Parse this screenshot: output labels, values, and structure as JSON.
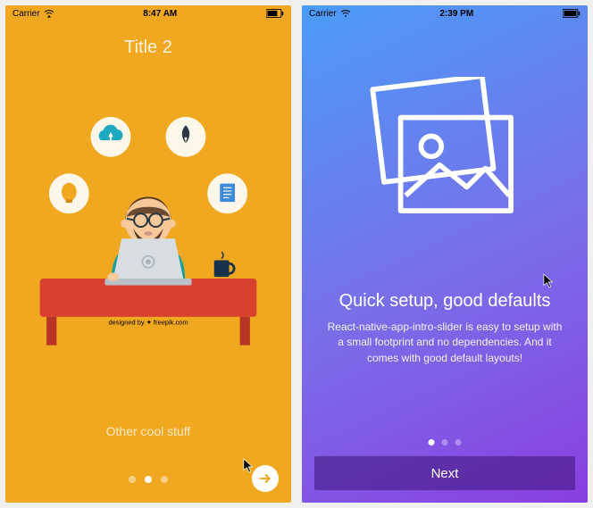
{
  "left": {
    "statusbar": {
      "carrier": "Carrier",
      "time": "8:47 AM"
    },
    "title": "Title 2",
    "attribution": "designed by ✦ freepik.com",
    "subtitle": "Other cool stuff",
    "dots": {
      "count": 3,
      "active": 1
    }
  },
  "right": {
    "statusbar": {
      "carrier": "Carrier",
      "time": "2:39 PM"
    },
    "title": "Quick setup, good defaults",
    "description": "React-native-app-intro-slider is easy to setup with a small footprint and no dependencies. And it comes with good default layouts!",
    "dots": {
      "count": 3,
      "active": 0
    },
    "next_label": "Next"
  }
}
